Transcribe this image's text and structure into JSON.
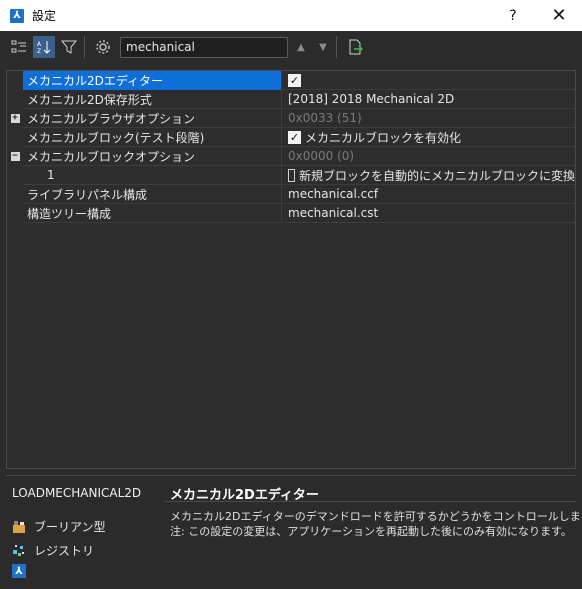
{
  "window": {
    "title": "設定",
    "help_label": "?",
    "close_label": "✕"
  },
  "toolbar": {
    "search_value": "mechanical",
    "icons": [
      "categorized-icon",
      "alphabetical-icon",
      "filter-icon",
      "settings-gear-icon",
      "up-arrow-icon",
      "down-arrow-icon",
      "export-icon"
    ]
  },
  "grid": {
    "rows": [
      {
        "name": "メカニカル2Dエディター",
        "value": "",
        "checkbox": true,
        "checked": true,
        "selected": true
      },
      {
        "name": "メカニカル2D保存形式",
        "value": "[2018] 2018 Mechanical 2D"
      },
      {
        "name": "メカニカルブラウザオプション",
        "value": "0x0033 (51)",
        "expander": "+",
        "dim": true
      },
      {
        "name": "メカニカルブロック(テスト段階)",
        "value": "メカニカルブロックを有効化",
        "checkbox": true,
        "checked": true
      },
      {
        "name": "メカニカルブロックオプション",
        "value": "0x0000 (0)",
        "expander": "−",
        "dim": true
      },
      {
        "name": "1",
        "value": "新規ブロックを自動的にメカニカルブロックに変換",
        "checkbox": true,
        "checked": false,
        "indent": true
      },
      {
        "name": "ライブラリパネル構成",
        "value": "mechanical.ccf"
      },
      {
        "name": "構造ツリー構成",
        "value": "mechanical.cst"
      }
    ]
  },
  "description": {
    "variable": "LOADMECHANICAL2D",
    "title": "メカニカル2Dエディター",
    "line1": "メカニカル2Dエディターのデマンドロードを許可するかどうかをコントロールします。",
    "line2": "注: この設定の変更は、アプリケーションを再起動した後にのみ有効になります。",
    "type_label": "ブーリアン型",
    "registry_label": "レジストリ"
  },
  "colors": {
    "selection": "#0f6fd8",
    "background": "#2b2b2b"
  }
}
